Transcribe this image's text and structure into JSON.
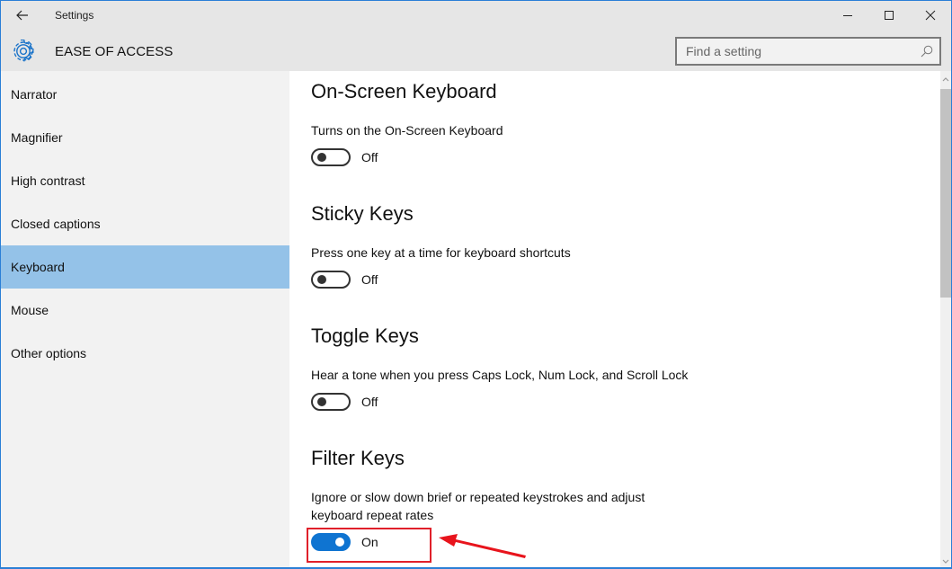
{
  "window": {
    "title": "Settings",
    "controls": {
      "minimize": "minimize",
      "maximize": "maximize",
      "close": "close"
    }
  },
  "header": {
    "section_title": "EASE OF ACCESS",
    "section_icon": "gear-icon",
    "search": {
      "placeholder": "Find a setting",
      "value": "",
      "icon": "search-icon"
    }
  },
  "sidebar": {
    "items": [
      {
        "label": "Narrator",
        "active": false
      },
      {
        "label": "Magnifier",
        "active": false
      },
      {
        "label": "High contrast",
        "active": false
      },
      {
        "label": "Closed captions",
        "active": false
      },
      {
        "label": "Keyboard",
        "active": true
      },
      {
        "label": "Mouse",
        "active": false
      },
      {
        "label": "Other options",
        "active": false
      }
    ]
  },
  "content": {
    "groups": [
      {
        "title": "On-Screen Keyboard",
        "description": "Turns on the On-Screen Keyboard",
        "toggle_state": "Off"
      },
      {
        "title": "Sticky Keys",
        "description": "Press one key at a time for keyboard shortcuts",
        "toggle_state": "Off"
      },
      {
        "title": "Toggle Keys",
        "description": "Hear a tone when you press Caps Lock, Num Lock, and Scroll Lock",
        "toggle_state": "Off"
      },
      {
        "title": "Filter Keys",
        "description": "Ignore or slow down brief or repeated keystrokes and adjust keyboard repeat rates",
        "toggle_state": "On"
      }
    ]
  },
  "annotation": {
    "highlight_color": "#e0202a",
    "target": "Filter Keys toggle"
  },
  "colors": {
    "accent": "#0f74d1",
    "selected_nav": "#94c2e8",
    "window_border": "#2b7fd6"
  }
}
